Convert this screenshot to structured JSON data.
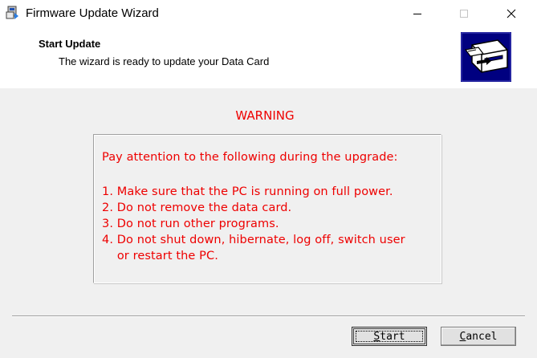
{
  "window": {
    "title": "Firmware Update Wizard",
    "app_icon": "wizard-app-icon",
    "controls": [
      "minimize-icon",
      "maximize-icon",
      "close-icon"
    ]
  },
  "header": {
    "title": "Start Update",
    "subtitle": "The wizard is ready to update your Data Card",
    "graphic_icon": "data-card-install-icon"
  },
  "warning": {
    "title": "WARNING",
    "intro": "Pay attention to the following during the upgrade:",
    "items": [
      "1. Make sure that the PC is running on full power.",
      "2. Do not remove the data card.",
      "3. Do not run other programs.",
      "4. Do not shut down, hibernate, log off, switch user",
      "    or restart the PC."
    ]
  },
  "buttons": {
    "start": {
      "accesskey": "S",
      "rest": "tart"
    },
    "cancel": {
      "accesskey": "C",
      "rest": "ancel"
    }
  },
  "colors": {
    "warning_text": "#ee0000",
    "window_bg": "#f0f0f0",
    "header_bg": "#ffffff",
    "graphic_bg": "#000080"
  }
}
